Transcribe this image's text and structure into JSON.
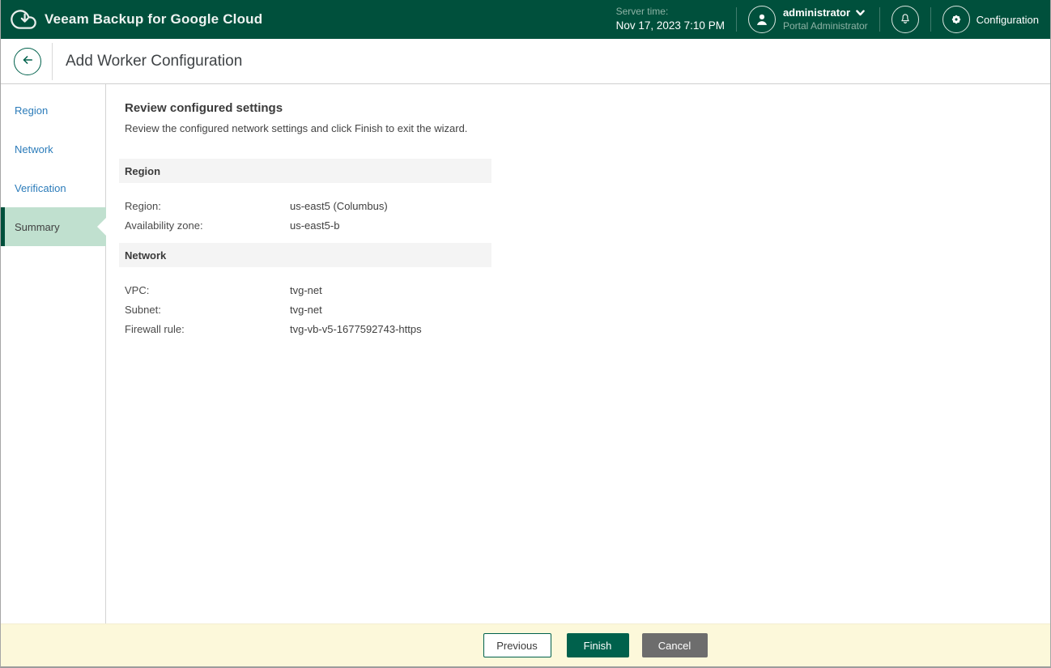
{
  "header": {
    "app_title": "Veeam Backup for Google Cloud",
    "server_time_label": "Server time:",
    "server_time_value": "Nov 17, 2023 7:10 PM",
    "user_name": "administrator",
    "user_role": "Portal Administrator",
    "configuration_label": "Configuration"
  },
  "page": {
    "title": "Add Worker Configuration"
  },
  "sidebar": {
    "steps": [
      {
        "label": "Region",
        "active": false
      },
      {
        "label": "Network",
        "active": false
      },
      {
        "label": "Verification",
        "active": false
      },
      {
        "label": "Summary",
        "active": true
      }
    ]
  },
  "content": {
    "heading": "Review configured settings",
    "subheading": "Review the configured network settings and click Finish to exit the wizard.",
    "sections": [
      {
        "title": "Region",
        "rows": [
          {
            "label": "Region:",
            "value": "us-east5 (Columbus)"
          },
          {
            "label": "Availability zone:",
            "value": "us-east5-b"
          }
        ]
      },
      {
        "title": "Network",
        "rows": [
          {
            "label": "VPC:",
            "value": "tvg-net"
          },
          {
            "label": "Subnet:",
            "value": "tvg-net"
          },
          {
            "label": "Firewall rule:",
            "value": "tvg-vb-v5-1677592743-https"
          }
        ]
      }
    ]
  },
  "footer": {
    "previous_label": "Previous",
    "finish_label": "Finish",
    "cancel_label": "Cancel"
  },
  "colors": {
    "header_bg": "#00503c",
    "accent_green": "#00614c",
    "active_step_bg": "#c0e0cf",
    "link_blue": "#2c7cba",
    "footer_bg": "#fcf8da",
    "cancel_gray": "#6d6d6d"
  }
}
